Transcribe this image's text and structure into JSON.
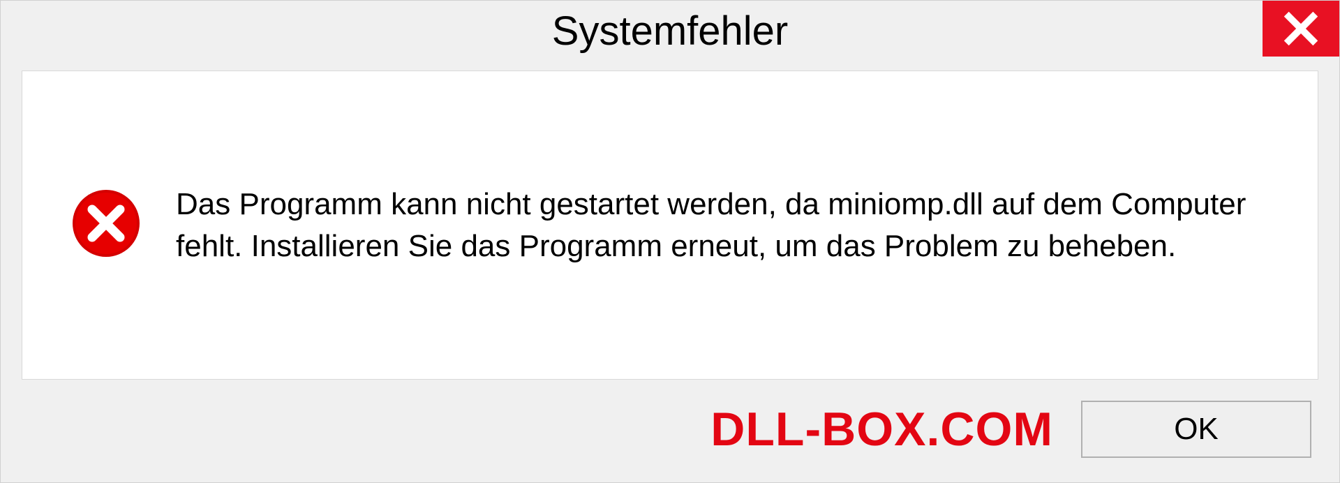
{
  "dialog": {
    "title": "Systemfehler",
    "message": "Das Programm kann nicht gestartet werden, da miniomp.dll auf dem Computer fehlt. Installieren Sie das Programm erneut, um das Problem zu beheben.",
    "ok_label": "OK"
  },
  "watermark": "DLL-BOX.COM",
  "icons": {
    "close": "close-icon",
    "error": "error-circle-icon"
  },
  "colors": {
    "close_bg": "#e81123",
    "error_icon": "#d40000",
    "watermark": "#e30613"
  }
}
